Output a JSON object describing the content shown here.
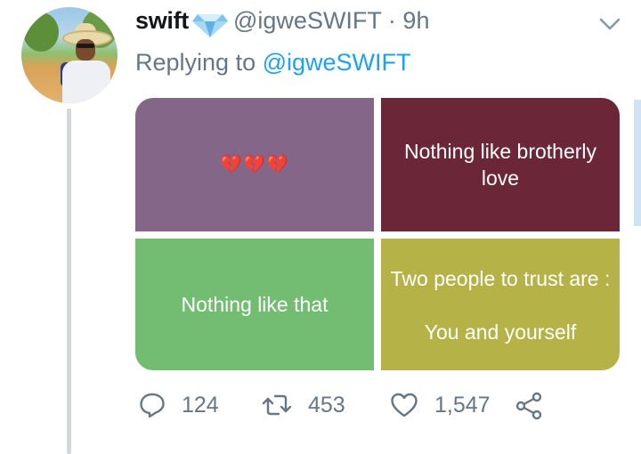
{
  "tweet": {
    "display_name": "swift",
    "handle_time": "@igweSWIFT · 9h",
    "replying_prefix": "Replying to",
    "replying_handle": "@igweSWIFT"
  },
  "media": {
    "tile_1_hearts": "💔💔💔",
    "tile_2_text": "Nothing like brotherly love",
    "tile_3_text": "Nothing like that",
    "tile_4_text": "Two people to trust are :\n\nYou and yourself"
  },
  "actions": {
    "reply_count": "124",
    "retweet_count": "453",
    "like_count": "1,547"
  },
  "icons": {
    "badge": "gem-icon",
    "menu": "chevron-down-icon",
    "reply": "reply-icon",
    "retweet": "retweet-icon",
    "like": "heart-icon",
    "share": "share-icon"
  },
  "colors": {
    "link": "#1da1f2",
    "muted": "#657786",
    "tile_1": "#846788",
    "tile_2": "#6b2737",
    "tile_3": "#73bd72",
    "tile_4": "#b5b248"
  }
}
